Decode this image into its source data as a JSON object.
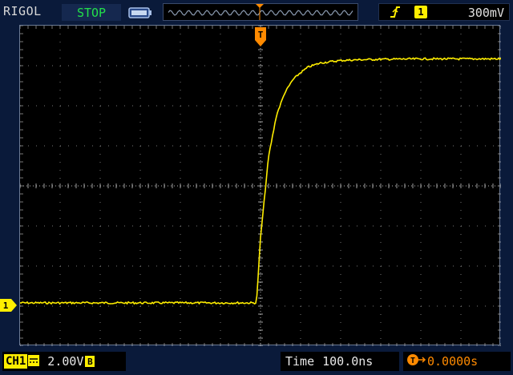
{
  "header": {
    "brand": "RIGOL",
    "run_status": "STOP",
    "trigger": {
      "edge_icon": "rising-edge-icon",
      "channel": "1",
      "level": "300mV"
    }
  },
  "channel": {
    "label": "CH1",
    "coupling_icon": "dc-coupling-icon",
    "scale": "2.00V",
    "bandwidth_badge": "B",
    "marker": "1"
  },
  "timebase": {
    "label": "Time",
    "value": "100.0ns"
  },
  "trigger_offset": {
    "icon": "T",
    "value": "0.0000s"
  },
  "trigger_marker": "T",
  "colors": {
    "trace": "#ffee00",
    "grid": "#c8c8c8",
    "trigger": "#ff8a00",
    "status_stop": "#22e04a",
    "frame": "#0a1a3a"
  },
  "chart_data": {
    "type": "line",
    "xlabel": "",
    "ylabel": "",
    "x_divisions": 12,
    "y_divisions": 8,
    "x_range_div": [
      -6,
      6
    ],
    "y_range_div": [
      -4,
      4
    ],
    "baseline_div": -2.92,
    "high_level_div": 3.17,
    "rise_start_div": -0.1,
    "series": [
      {
        "x_div": [
          -6,
          -0.1,
          0,
          0.2,
          0.4,
          0.6,
          0.8,
          1.0,
          1.2,
          1.5,
          2.0,
          2.5,
          3.0,
          4.0,
          5.0,
          6.0
        ],
        "y_div": [
          -2.92,
          -2.92,
          -1.3,
          0.72,
          1.77,
          2.31,
          2.64,
          2.83,
          2.97,
          3.07,
          3.13,
          3.15,
          3.16,
          3.17,
          3.17,
          3.17
        ]
      }
    ]
  }
}
